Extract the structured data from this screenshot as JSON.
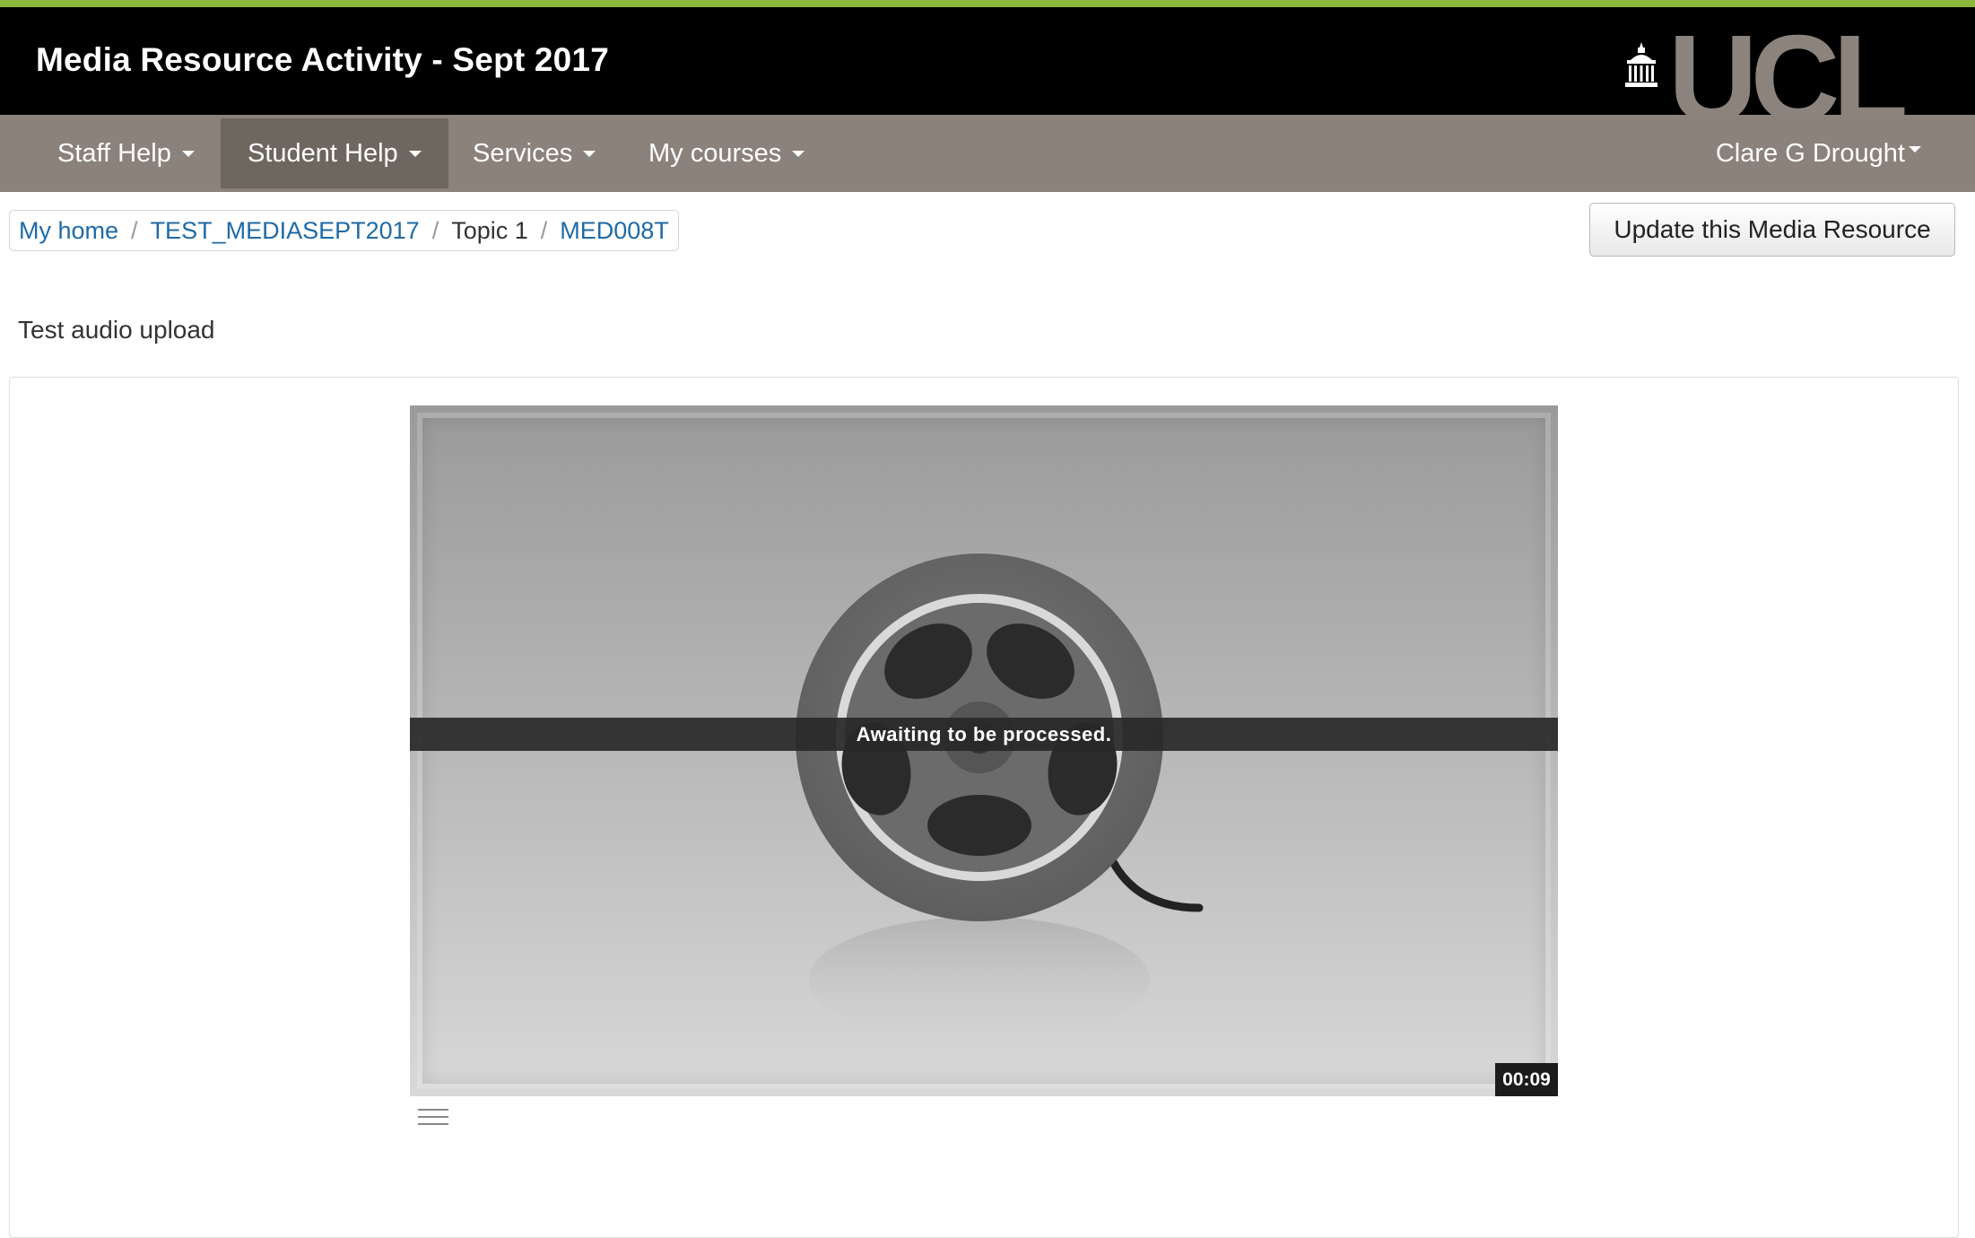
{
  "header": {
    "site_title": "Media Resource Activity - Sept 2017",
    "logo_text": "UCL"
  },
  "colors": {
    "accent": "#8db63c",
    "header_bg": "#000000",
    "nav_bg": "#8a827b",
    "nav_active_bg": "#6e6760",
    "link": "#1f6aa5"
  },
  "nav": {
    "items": [
      {
        "label": "Staff Help"
      },
      {
        "label": "Student Help"
      },
      {
        "label": "Services"
      },
      {
        "label": "My courses"
      }
    ],
    "user_name": "Clare G Drought"
  },
  "breadcrumb": {
    "items": [
      {
        "label": "My home"
      },
      {
        "label": "TEST_MEDIASEPT2017"
      },
      {
        "label": "Topic 1"
      },
      {
        "label": "MED008T"
      }
    ]
  },
  "actions": {
    "update_label": "Update this Media Resource"
  },
  "content": {
    "description": "Test audio upload"
  },
  "player": {
    "status": "Awaiting to be processed.",
    "duration": "00:09"
  }
}
